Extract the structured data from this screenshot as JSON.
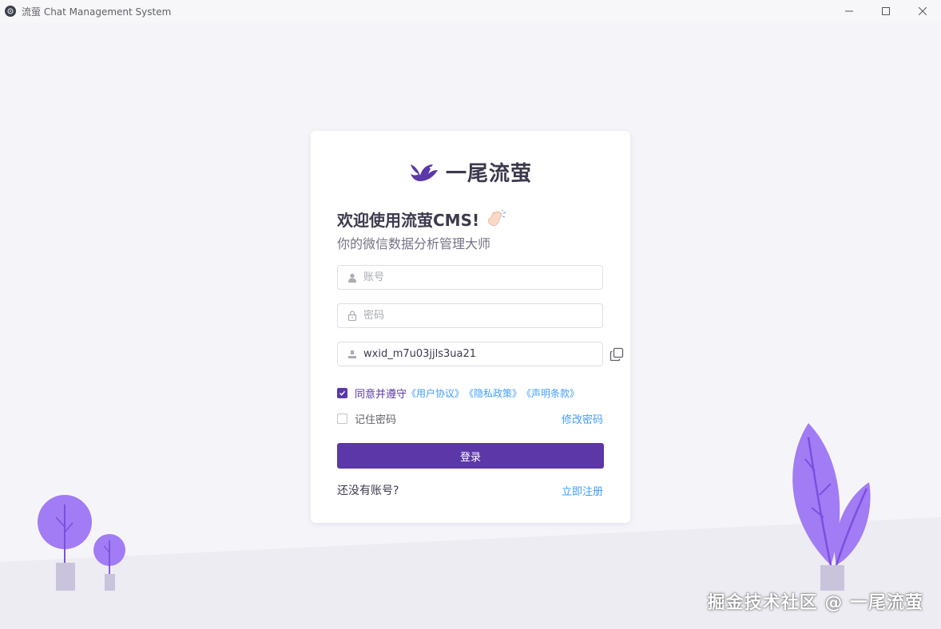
{
  "window": {
    "title": "流萤 Chat Management System",
    "minimize_glyph": "—",
    "maximize_glyph": "☐",
    "close_glyph": "✕"
  },
  "brand": {
    "name": "一尾流萤",
    "logo_icon": "bird-icon",
    "color": "#5b37a8"
  },
  "login": {
    "welcome": "欢迎使用流萤CMS!",
    "welcome_icon": "waving-hand-icon",
    "subtitle": "你的微信数据分析管理大师",
    "account_placeholder": "账号",
    "password_placeholder": "密码",
    "wxid_value": "wxid_m7u03jjls3ua21",
    "agree": {
      "checked": true,
      "text": "同意并遵守",
      "links": [
        "《用户协议》",
        "《隐私政策》",
        "《声明条款》"
      ]
    },
    "remember": {
      "checked": false,
      "label": "记住密码"
    },
    "forgot_label": "修改密码",
    "login_button": "登录",
    "no_account": "还没有账号?",
    "signup_link": "立即注册"
  },
  "watermark": "掘金技术社区 @ 一尾流萤",
  "colors": {
    "accent": "#5b37a8",
    "link": "#409eff",
    "background": "#f5f5f9"
  }
}
